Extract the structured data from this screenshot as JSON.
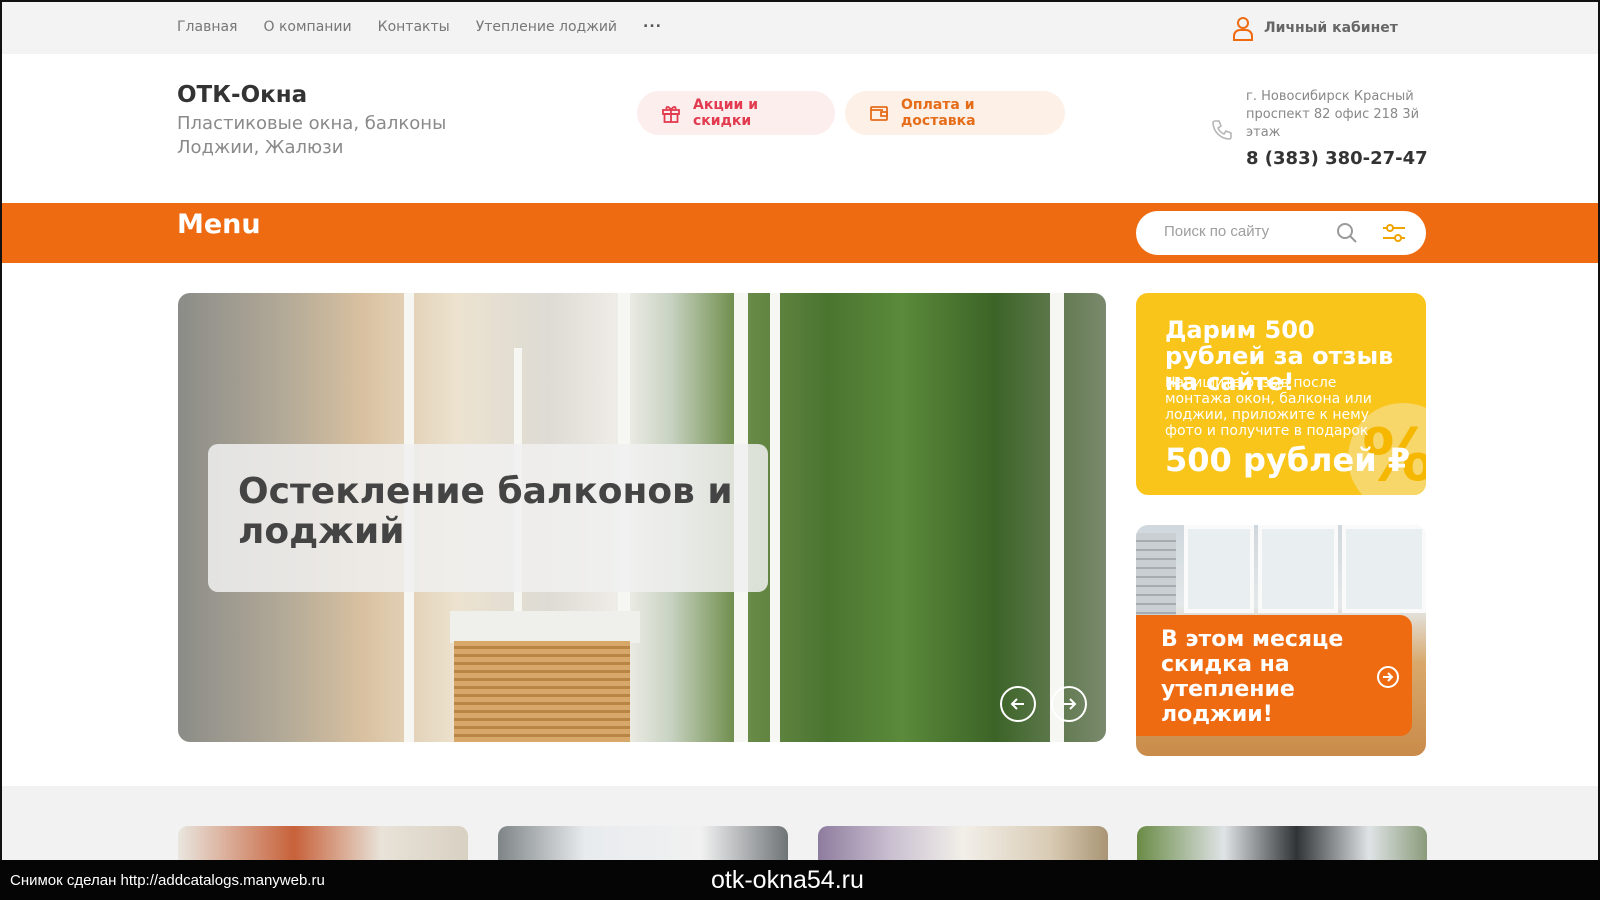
{
  "topnav": {
    "items": [
      "Главная",
      "О компании",
      "Контакты",
      "Утепление лоджий"
    ],
    "more": "..."
  },
  "cabinet": {
    "label": "Личный кабинет",
    "icon": "user-icon"
  },
  "brand": {
    "name": "ОТК-Окна",
    "tagline": "Пластиковые окна, балконы\nЛоджии, Жалюзи"
  },
  "header": {
    "promo_label": "Акции и скидки",
    "promo_icon": "gift-icon",
    "pay_label": "Оплата и доставка",
    "pay_icon": "wallet-icon"
  },
  "contacts": {
    "address": "г. Новосибирск Красный проспект 82 офис 218 3й этаж",
    "phone": "8 (383) 380-27-47",
    "icon": "phone-icon"
  },
  "menubar": {
    "menu_label": "Menu",
    "search_placeholder": "Поиск по сайту"
  },
  "hero": {
    "title": "Остекление балконов и лоджий"
  },
  "promo_card": {
    "headline": "Дарим 500 рублей за отзыв на сайте!",
    "body": "Напишите отзыв после монтажа окон, балкона или лоджии, приложите к нему фото и получите в подарок",
    "amount": "500 рублей ₽",
    "badge": "%"
  },
  "promo_card2": {
    "text": "В этом месяце скидка на утепление лоджии!"
  },
  "shotbar": {
    "credit": "Снимок сделан http://addcatalogs.manyweb.ru",
    "site": "otk-okna54.ru"
  },
  "colors": {
    "accent": "#ee6b12",
    "promo_pill_text": "#e23b4f",
    "promo_pill_bg": "#fdeeee",
    "pay_pill_text": "#e56d1a",
    "pay_pill_bg": "#fdf0e7",
    "yellow_card": "#f9c51a"
  }
}
